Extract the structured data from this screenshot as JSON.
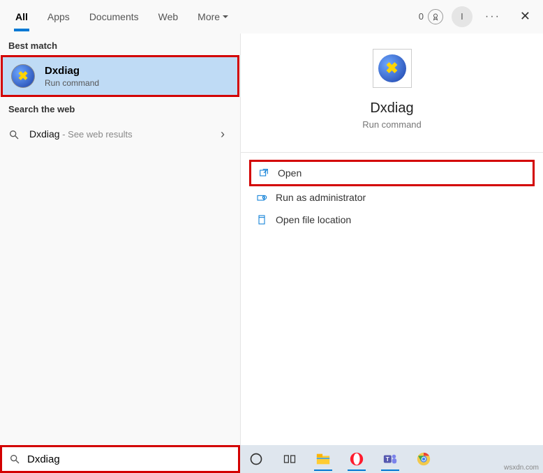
{
  "tabs": {
    "all": "All",
    "apps": "Apps",
    "documents": "Documents",
    "web": "Web",
    "more": "More"
  },
  "topbar": {
    "score": "0",
    "avatar_initial": "I"
  },
  "sections": {
    "best_match": "Best match",
    "search_web": "Search the web"
  },
  "best_match": {
    "title": "Dxdiag",
    "subtitle": "Run command"
  },
  "web_result": {
    "term": "Dxdiag",
    "suffix": " - See web results"
  },
  "details": {
    "title": "Dxdiag",
    "subtitle": "Run command"
  },
  "actions": {
    "open": "Open",
    "run_admin": "Run as administrator",
    "open_location": "Open file location"
  },
  "search_value": "Dxdiag",
  "watermark": "wsxdn.com"
}
